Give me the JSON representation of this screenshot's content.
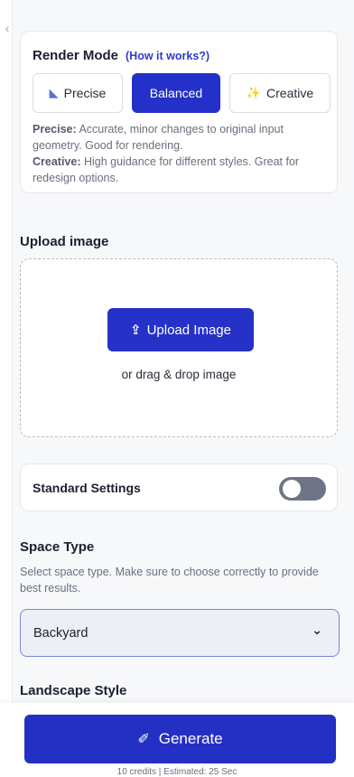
{
  "render_mode": {
    "title": "Render Mode",
    "help_link": "(How it works?)",
    "modes": [
      {
        "label": "Precise",
        "icon": "ruler-icon",
        "active": false
      },
      {
        "label": "Balanced",
        "icon": "",
        "active": true
      },
      {
        "label": "Creative",
        "icon": "sparkle-icon",
        "active": false
      }
    ],
    "description": {
      "precise_label": "Precise:",
      "precise_text": " Accurate, minor changes to original input geometry. Good for rendering.",
      "creative_label": "Creative:",
      "creative_text": " High guidance for different styles. Great for redesign options."
    }
  },
  "upload": {
    "title": "Upload image",
    "button_label": "Upload Image",
    "drag_text": "or drag & drop image"
  },
  "standard_settings": {
    "label": "Standard Settings",
    "enabled": false
  },
  "space_type": {
    "title": "Space Type",
    "description": "Select space type. Make sure to choose correctly to provide best results.",
    "selected": "Backyard"
  },
  "landscape_style": {
    "title": "Landscape Style"
  },
  "footer": {
    "generate_label": "Generate",
    "credits_text": "10 credits | Estimated: 25 Sec"
  },
  "colors": {
    "accent": "#2430c4",
    "link": "#2d3bd1",
    "toggle_off": "#6e7486"
  }
}
